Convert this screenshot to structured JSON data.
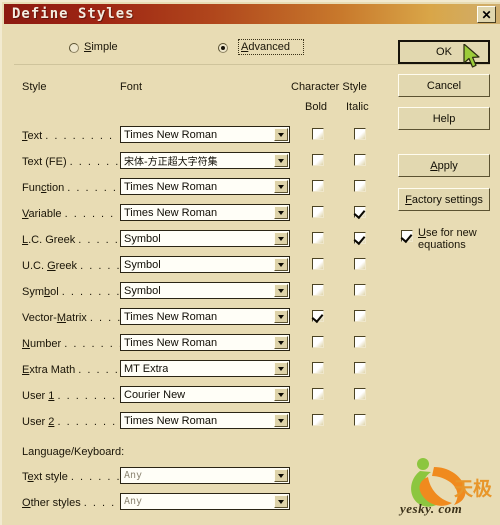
{
  "window": {
    "title": "Define Styles",
    "close_label": "✕"
  },
  "mode": {
    "simple_label": "Simple",
    "advanced_label": "Advanced",
    "selected": "Advanced"
  },
  "headers": {
    "style": "Style",
    "font": "Font",
    "character_style": "Character Style",
    "bold": "Bold",
    "italic": "Italic"
  },
  "rows": [
    {
      "label": "Text",
      "accel": "T",
      "dots": ". . . . . . . .",
      "font": "Times New Roman",
      "bold": false,
      "italic": false,
      "cjk": false
    },
    {
      "label": "Text (FE)",
      "accel": "",
      "dots": ". . . . . .",
      "font": "宋体-方正超大字符集",
      "bold": false,
      "italic": false,
      "cjk": true
    },
    {
      "label": "Function",
      "accel": "c",
      "dots": ". . . . . .",
      "font": "Times New Roman",
      "bold": false,
      "italic": false,
      "cjk": false
    },
    {
      "label": "Variable",
      "accel": "V",
      "dots": ". . . . . .",
      "font": "Times New Roman",
      "bold": false,
      "italic": true,
      "cjk": false
    },
    {
      "label": "L.C. Greek",
      "accel": "L",
      "dots": ". . . . .",
      "font": "Symbol",
      "bold": false,
      "italic": true,
      "cjk": false
    },
    {
      "label": "U.C. Greek",
      "accel": "G",
      "dots": ". . . . .",
      "font": "Symbol",
      "bold": false,
      "italic": false,
      "cjk": false
    },
    {
      "label": "Symbol",
      "accel": "b",
      "dots": ". . . . . . .",
      "font": "Symbol",
      "bold": false,
      "italic": false,
      "cjk": false
    },
    {
      "label": "Vector-Matrix",
      "accel": "M",
      "dots": ". . . .",
      "font": "Times New Roman",
      "bold": true,
      "italic": false,
      "cjk": false
    },
    {
      "label": "Number",
      "accel": "N",
      "dots": ". . . . . . .",
      "font": "Times New Roman",
      "bold": false,
      "italic": false,
      "cjk": false
    },
    {
      "label": "Extra Math",
      "accel": "E",
      "dots": ". . . . .",
      "font": "MT Extra",
      "bold": false,
      "italic": false,
      "cjk": false
    },
    {
      "label": "User 1",
      "accel": "1",
      "dots": ". . . . . . . .",
      "font": "Courier New",
      "bold": false,
      "italic": false,
      "cjk": false
    },
    {
      "label": "User 2",
      "accel": "2",
      "dots": ". . . . . . . .",
      "font": "Times New Roman",
      "bold": false,
      "italic": false,
      "cjk": false
    }
  ],
  "language": {
    "section_label": "Language/Keyboard:",
    "text_style_label": "Text style",
    "text_style_dots": ". . . . . .",
    "text_style_value": "Any",
    "other_styles_label": "Other styles",
    "other_styles_dots": ". . . . .",
    "other_styles_value": "Any"
  },
  "buttons": {
    "ok": "OK",
    "cancel": "Cancel",
    "help": "Help",
    "apply": "Apply",
    "factory_settings": "Factory settings"
  },
  "use_for_new": {
    "line1": "Use for new",
    "line2": "equations",
    "checked": true
  },
  "watermark": {
    "text": "yesky. com",
    "cn": "天极"
  },
  "colors": {
    "dialog_bg": "#e8dcb4",
    "title_start": "#8c1a10",
    "title_end": "#cfae6e",
    "field_bg": "#fffef7",
    "text": "#1a1508",
    "disabled_text": "#8e8774",
    "accent_orange": "#e8962a",
    "accent_green": "#8cc63f"
  }
}
